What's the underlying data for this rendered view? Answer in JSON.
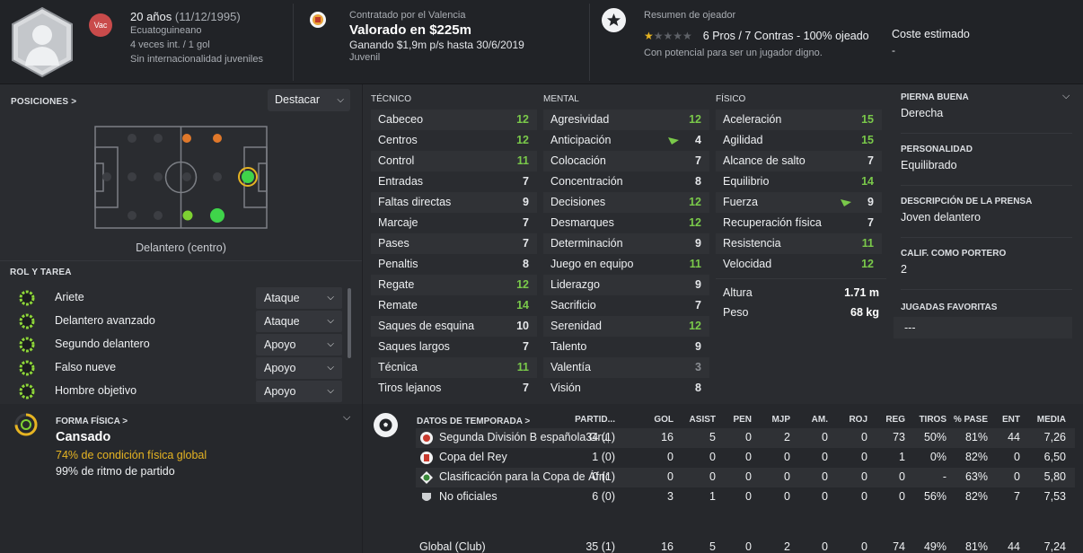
{
  "header": {
    "age": "20 años",
    "birthdate": "(11/12/1995)",
    "nationality": "Ecuatoguineano",
    "caps": "4 veces int. / 1 gol",
    "youth_caps": "Sin internacionalidad juveniles",
    "badge": "Vac",
    "contract_label": "Contratado por el Valencia",
    "value": "Valorado en $225m",
    "wage": "Ganando $1,9m p/s hasta 30/6/2019",
    "squad": "Juvenil",
    "scout_label": "Resumen de ojeador",
    "scout_stars": 1,
    "scout_stars_max": 5,
    "scout_summary": "6 Pros / 7 Contras - 100% ojeado",
    "scout_desc": "Con potencial para ser un jugador digno.",
    "cost_label": "Coste estimado",
    "cost_value": "-"
  },
  "positions": {
    "title": "POSICIONES >",
    "dropdown": "Destacar",
    "label": "Delantero (centro)"
  },
  "roles": {
    "title": "ROL Y TAREA",
    "items": [
      {
        "name": "Ariete",
        "duty": "Ataque"
      },
      {
        "name": "Delantero avanzado",
        "duty": "Ataque"
      },
      {
        "name": "Segundo delantero",
        "duty": "Apoyo"
      },
      {
        "name": "Falso nueve",
        "duty": "Apoyo"
      },
      {
        "name": "Hombre objetivo",
        "duty": "Apoyo"
      }
    ]
  },
  "attributes": {
    "technical_title": "TÉCNICO",
    "mental_title": "MENTAL",
    "physical_title": "FÍSICO",
    "technical": [
      {
        "name": "Cabeceo",
        "value": "12"
      },
      {
        "name": "Centros",
        "value": "12"
      },
      {
        "name": "Control",
        "value": "11"
      },
      {
        "name": "Entradas",
        "value": "7"
      },
      {
        "name": "Faltas directas",
        "value": "9"
      },
      {
        "name": "Marcaje",
        "value": "7"
      },
      {
        "name": "Pases",
        "value": "7"
      },
      {
        "name": "Penaltis",
        "value": "8"
      },
      {
        "name": "Regate",
        "value": "12"
      },
      {
        "name": "Remate",
        "value": "14"
      },
      {
        "name": "Saques de esquina",
        "value": "10"
      },
      {
        "name": "Saques largos",
        "value": "7"
      },
      {
        "name": "Técnica",
        "value": "11"
      },
      {
        "name": "Tiros lejanos",
        "value": "7"
      }
    ],
    "mental": [
      {
        "name": "Agresividad",
        "value": "12"
      },
      {
        "name": "Anticipación",
        "value": "4"
      },
      {
        "name": "Colocación",
        "value": "7"
      },
      {
        "name": "Concentración",
        "value": "8"
      },
      {
        "name": "Decisiones",
        "value": "12"
      },
      {
        "name": "Desmarques",
        "value": "12"
      },
      {
        "name": "Determinación",
        "value": "9"
      },
      {
        "name": "Juego en equipo",
        "value": "11"
      },
      {
        "name": "Liderazgo",
        "value": "9"
      },
      {
        "name": "Sacrificio",
        "value": "7"
      },
      {
        "name": "Serenidad",
        "value": "12"
      },
      {
        "name": "Talento",
        "value": "9"
      },
      {
        "name": "Valentía",
        "value": "3"
      },
      {
        "name": "Visión",
        "value": "8"
      }
    ],
    "physical": [
      {
        "name": "Aceleración",
        "value": "15"
      },
      {
        "name": "Agilidad",
        "value": "15"
      },
      {
        "name": "Alcance de salto",
        "value": "7"
      },
      {
        "name": "Equilibrio",
        "value": "14"
      },
      {
        "name": "Fuerza",
        "value": "9"
      },
      {
        "name": "Recuperación física",
        "value": "7"
      },
      {
        "name": "Resistencia",
        "value": "11"
      },
      {
        "name": "Velocidad",
        "value": "12"
      }
    ],
    "height_label": "Altura",
    "height": "1.71 m",
    "weight_label": "Peso",
    "weight": "68 kg"
  },
  "info": {
    "foot_label": "PIERNA BUENA",
    "foot": "Derecha",
    "personality_label": "PERSONALIDAD",
    "personality": "Equilibrado",
    "press_label": "DESCRIPCIÓN DE LA PRENSA",
    "press": "Joven delantero",
    "gk_label": "CALIF. COMO PORTERO",
    "gk": "2",
    "fav_label": "JUGADAS FAVORITAS",
    "fav": "---"
  },
  "fitness": {
    "title": "FORMA FÍSICA >",
    "status": "Cansado",
    "condition": "74% de condición física global",
    "match": "99% de ritmo de partido",
    "condition_pct": 74
  },
  "season": {
    "title": "DATOS DE TEMPORADA >",
    "headers": [
      "PARTID...",
      "GOL",
      "ASIST",
      "PEN",
      "MJP",
      "AM.",
      "ROJ",
      "REG",
      "TIROS",
      "% PASE",
      "ENT",
      "MEDIA"
    ],
    "rows": [
      {
        "comp": "Segunda División B española Grupo 3",
        "cells": [
          "34 (1)",
          "16",
          "5",
          "0",
          "2",
          "0",
          "0",
          "73",
          "50%",
          "81%",
          "44",
          "7,26"
        ]
      },
      {
        "comp": "Copa del Rey",
        "cells": [
          "1 (0)",
          "0",
          "0",
          "0",
          "0",
          "0",
          "0",
          "1",
          "0%",
          "82%",
          "0",
          "6,50"
        ]
      },
      {
        "comp": "Clasificación para la Copa de África",
        "cells": [
          "0 (1)",
          "0",
          "0",
          "0",
          "0",
          "0",
          "0",
          "0",
          "-",
          "63%",
          "0",
          "5,80"
        ]
      },
      {
        "comp": "No oficiales",
        "cells": [
          "6 (0)",
          "3",
          "1",
          "0",
          "0",
          "0",
          "0",
          "0",
          "56%",
          "82%",
          "7",
          "7,53"
        ]
      }
    ],
    "total": {
      "comp": "Global (Club)",
      "cells": [
        "35 (1)",
        "16",
        "5",
        "0",
        "2",
        "0",
        "0",
        "74",
        "49%",
        "81%",
        "44",
        "7,24"
      ]
    }
  }
}
